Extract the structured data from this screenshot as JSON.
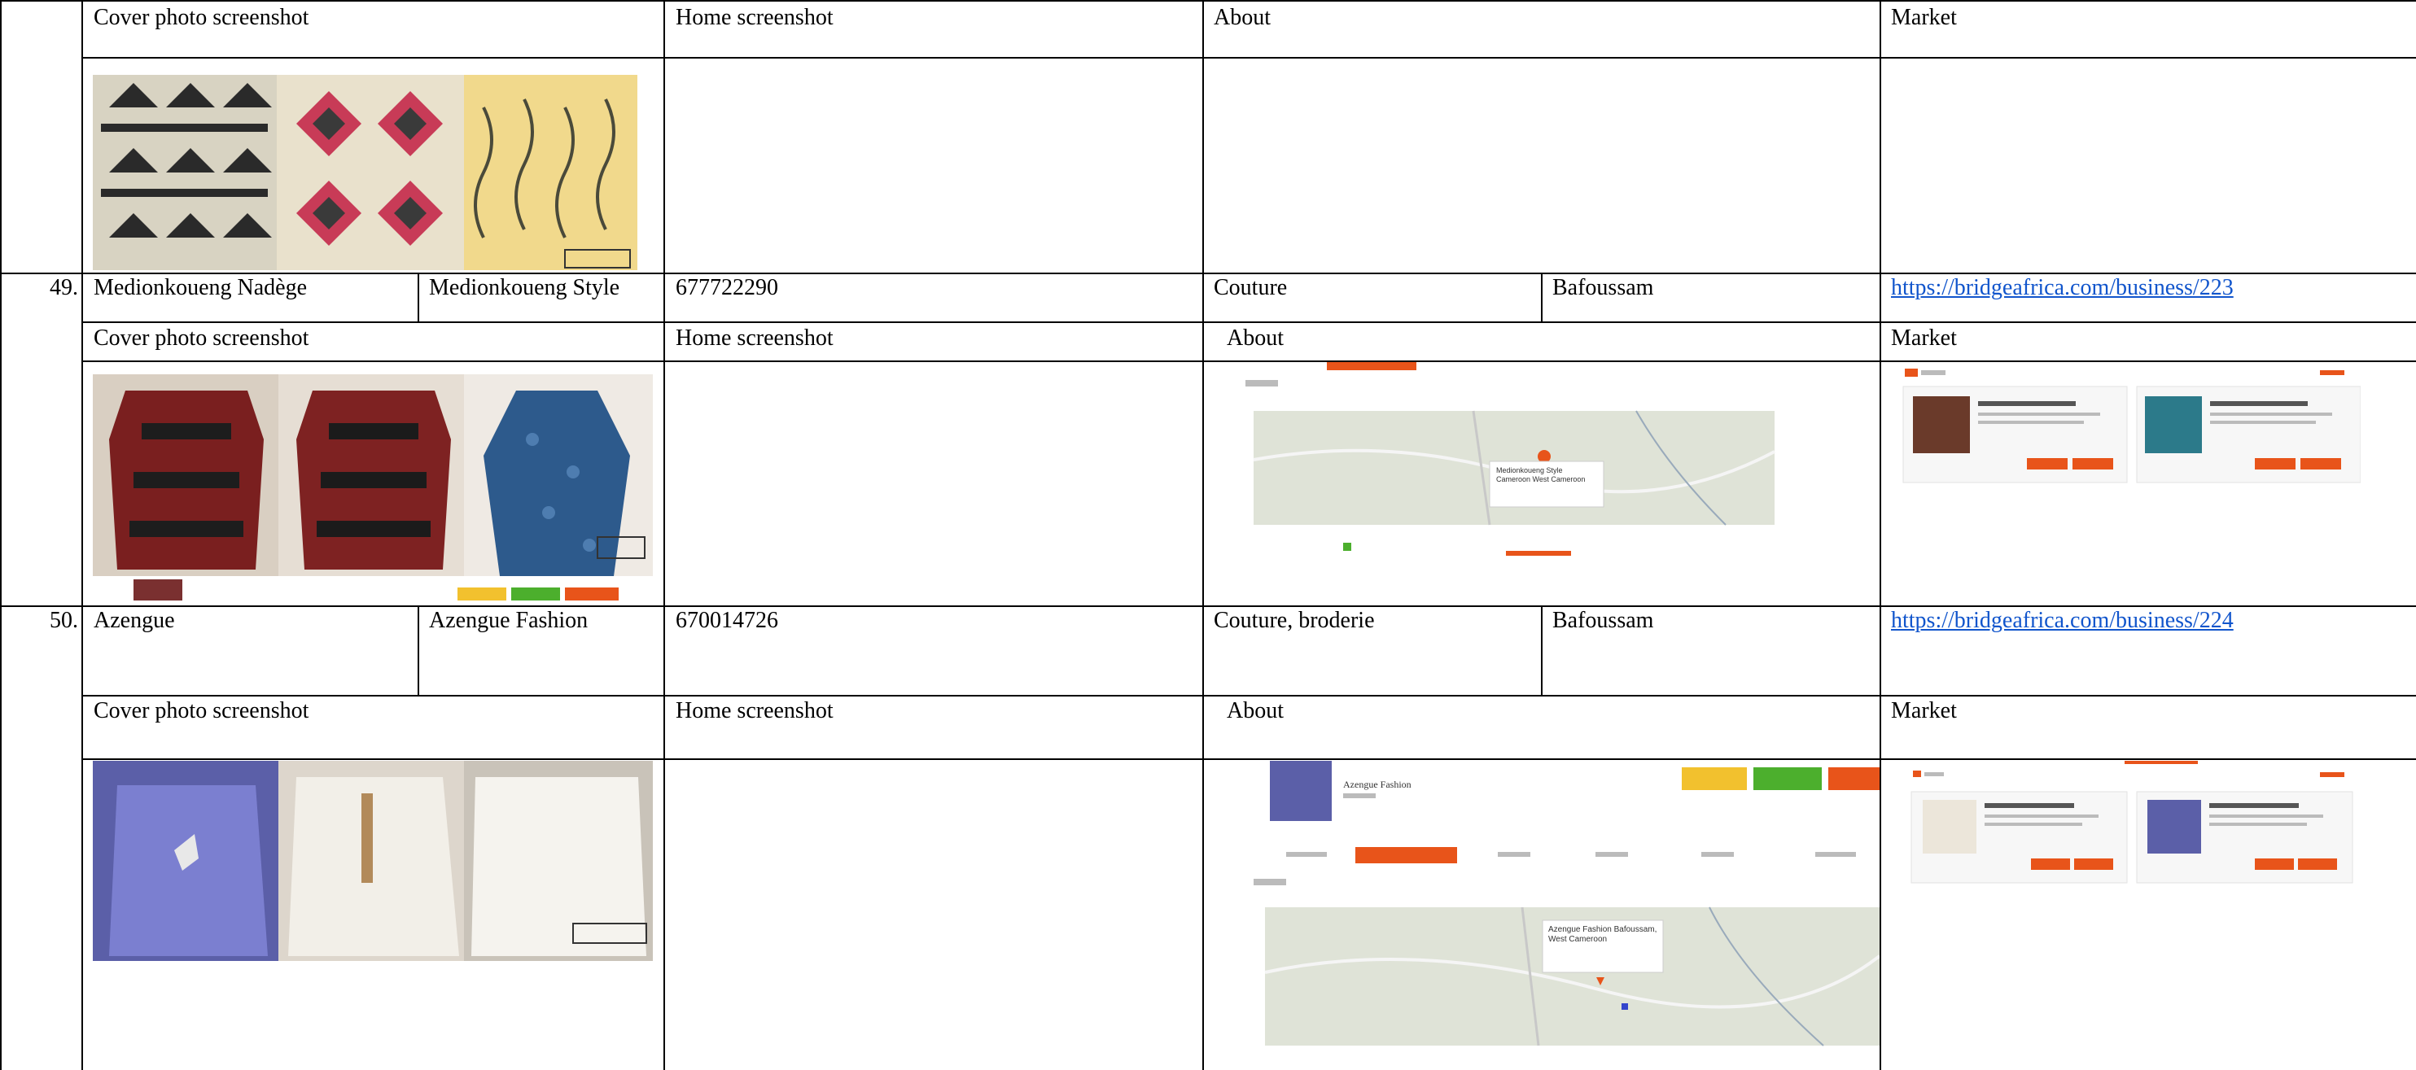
{
  "table": {
    "headers": {
      "cover": "Cover photo screenshot",
      "home": "Home screenshot",
      "about": "About",
      "market": "Market"
    },
    "rows": [
      {
        "number": "49.",
        "name": "Medionkoueng Nadège",
        "business": "Medionkoueng Style",
        "phone": "677722290",
        "activity": "Couture",
        "city": "Bafoussam",
        "url": "https://bridgeafrica.com/business/223"
      },
      {
        "number": "50.",
        "name": "Azengue",
        "business": "Azengue Fashion",
        "phone": "670014726",
        "activity": "Couture, broderie",
        "city": "Bafoussam",
        "url": "https://bridgeafrica.com/business/224"
      }
    ]
  },
  "about_shots": {
    "map_label_49": "Medionkoueng Style Cameroon West Cameroon",
    "map_label_50": "Azengue Fashion Bafoussam, West Cameroon",
    "title_50": "Azengue Fashion"
  },
  "colors": {
    "accent_orange": "#e8541a",
    "accent_green": "#4caf2d",
    "accent_yellow": "#f2c12e",
    "link": "#1155cc"
  }
}
